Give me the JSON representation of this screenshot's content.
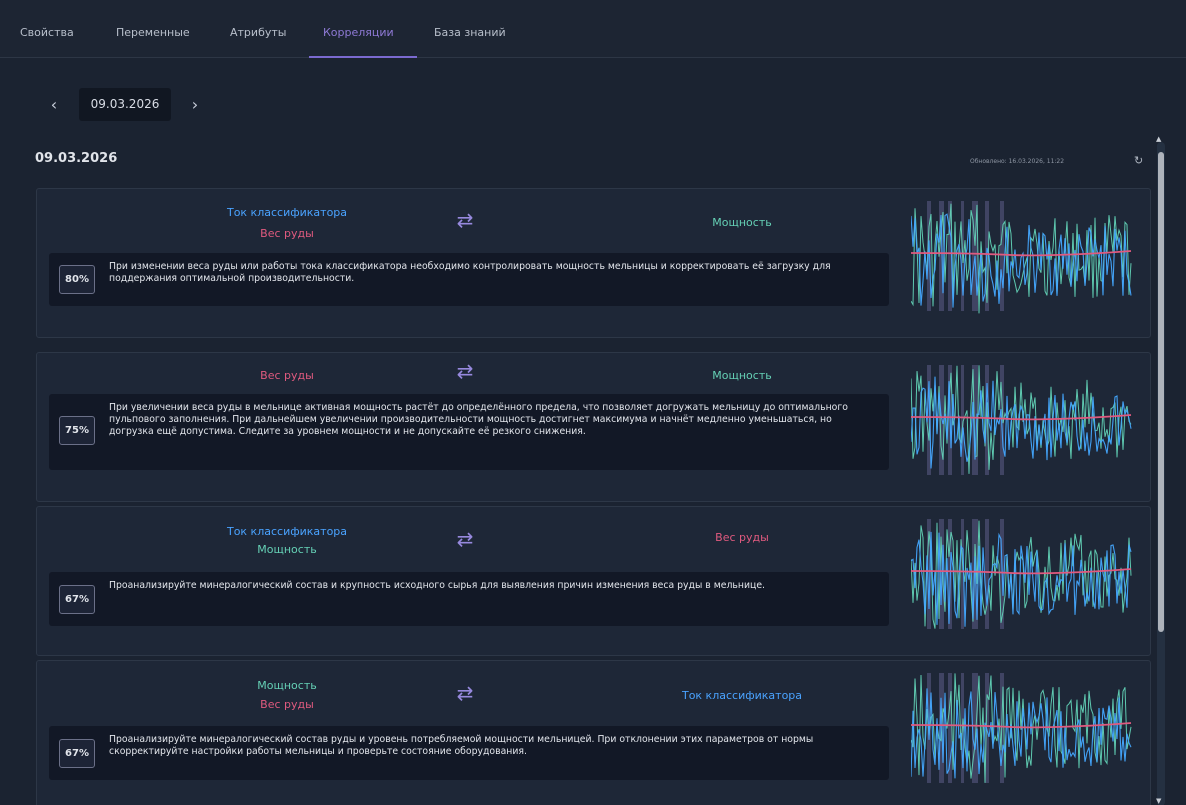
{
  "tabs": [
    {
      "label": "Свойства",
      "active": false
    },
    {
      "label": "Переменные",
      "active": false
    },
    {
      "label": "Атрибуты",
      "active": false
    },
    {
      "label": "Корреляции",
      "active": true
    },
    {
      "label": "База знаний",
      "active": false
    }
  ],
  "date_picker": {
    "value": "09.03.2026",
    "prev_icon": "chevron-left-icon",
    "next_icon": "chevron-right-icon"
  },
  "section": {
    "date": "09.03.2026",
    "updated": "Обновлено: 16.03.2026, 11:22",
    "refresh_icon": "refresh-icon"
  },
  "colors": {
    "blue": "#4aa3ff",
    "pink": "#e05a7f",
    "green": "#65d0b5",
    "accent": "#7b6ad0",
    "background": "#1b2331"
  },
  "correlations": [
    {
      "left": [
        {
          "text": "Ток классификатора",
          "color": "blue"
        },
        {
          "text": "Вес руды",
          "color": "pink"
        }
      ],
      "right": [
        {
          "text": "Мощность",
          "color": "green"
        }
      ],
      "percent": "80%",
      "description": "При изменении веса руды или работы тока классификатора необходимо контролировать мощность мельницы и корректировать её загрузку для поддержания оптимальной производительности."
    },
    {
      "left": [
        {
          "text": "Вес руды",
          "color": "pink"
        }
      ],
      "right": [
        {
          "text": "Мощность",
          "color": "green"
        }
      ],
      "percent": "75%",
      "description": "При увеличении веса руды в мельнице активная мощность растёт до определённого предела, что позволяет догружать мельницу до оптимального пульпового заполнения. При дальнейшем увеличении производительности мощность достигнет максимума и начнёт медленно уменьшаться, но догрузка ещё допустима. Следите за уровнем мощности и не допускайте её резкого снижения."
    },
    {
      "left": [
        {
          "text": "Ток классификатора",
          "color": "blue"
        },
        {
          "text": "Мощность",
          "color": "green"
        }
      ],
      "right": [
        {
          "text": "Вес руды",
          "color": "pink"
        }
      ],
      "percent": "67%",
      "description": "Проанализируйте минералогический состав и крупность исходного сырья для выявления причин изменения веса руды в мельнице."
    },
    {
      "left": [
        {
          "text": "Мощность",
          "color": "green"
        },
        {
          "text": "Вес руды",
          "color": "pink"
        }
      ],
      "right": [
        {
          "text": "Ток классификатора",
          "color": "blue"
        }
      ],
      "percent": "67%",
      "description": "Проанализируйте минералогический состав руды и уровень потребляемой мощности мельницей. При отклонении этих параметров от нормы скорректируйте настройки работы мельницы и проверьте состояние оборудования."
    }
  ]
}
